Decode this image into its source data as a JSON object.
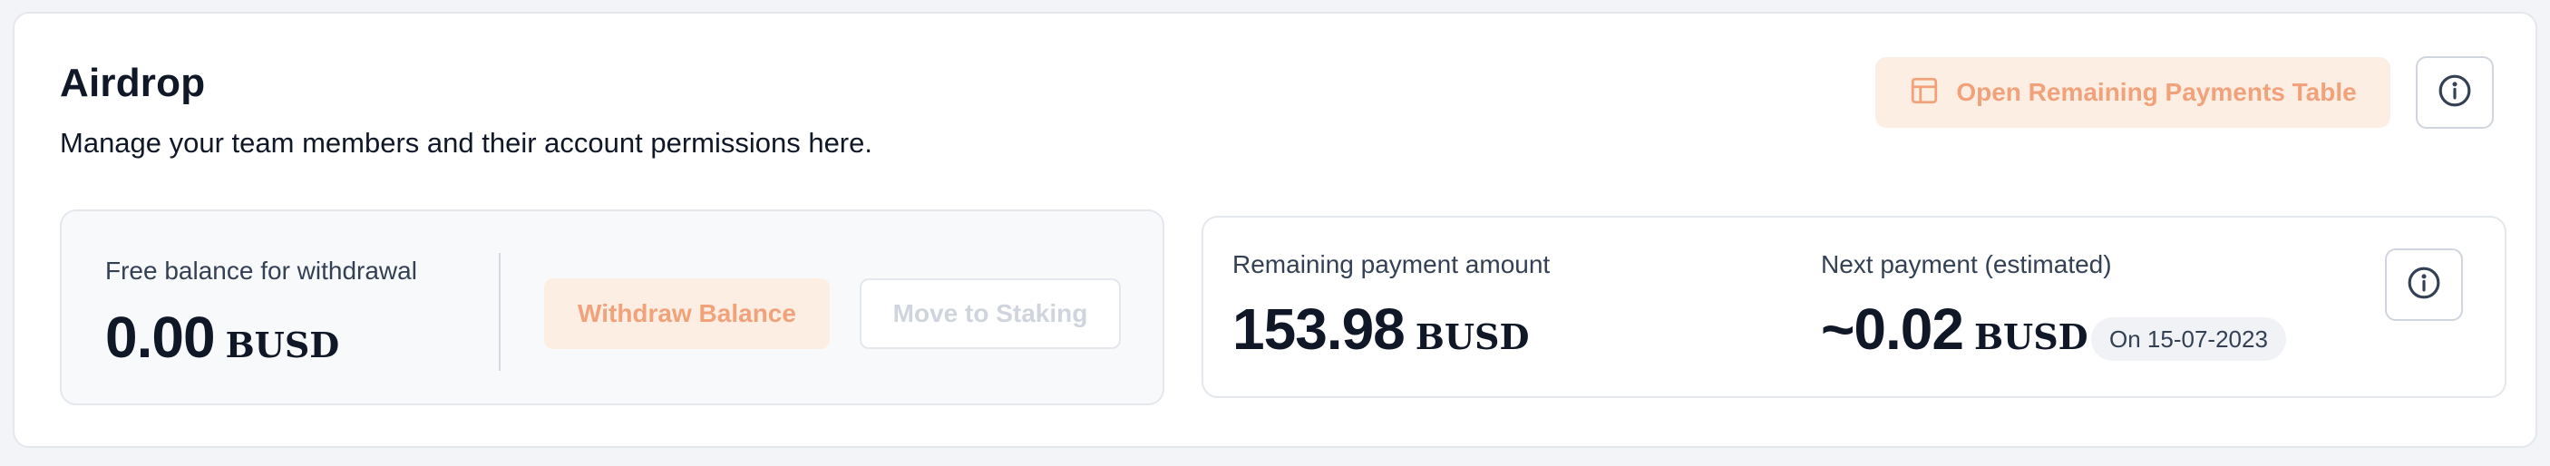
{
  "header": {
    "title": "Airdrop",
    "subtitle": "Manage your team members and their account permissions here.",
    "open_table_label": "Open Remaining Payments Table"
  },
  "balance": {
    "label": "Free balance for withdrawal",
    "amount": "0.00",
    "currency": "BUSD",
    "withdraw_label": "Withdraw Balance",
    "staking_label": "Move to Staking"
  },
  "payments": {
    "remaining_label": "Remaining payment amount",
    "remaining_amount": "153.98",
    "remaining_currency": "BUSD",
    "next_label": "Next payment (estimated)",
    "next_amount": "~0.02",
    "next_currency": "BUSD",
    "next_date": "On 15-07-2023"
  },
  "icons": {
    "table": "table-icon",
    "info": "info-icon"
  },
  "colors": {
    "accent": "#f1a27a",
    "accent_bg": "#fdeee4",
    "text": "#101828",
    "muted": "#344054",
    "disabled": "#d0d5dd"
  }
}
